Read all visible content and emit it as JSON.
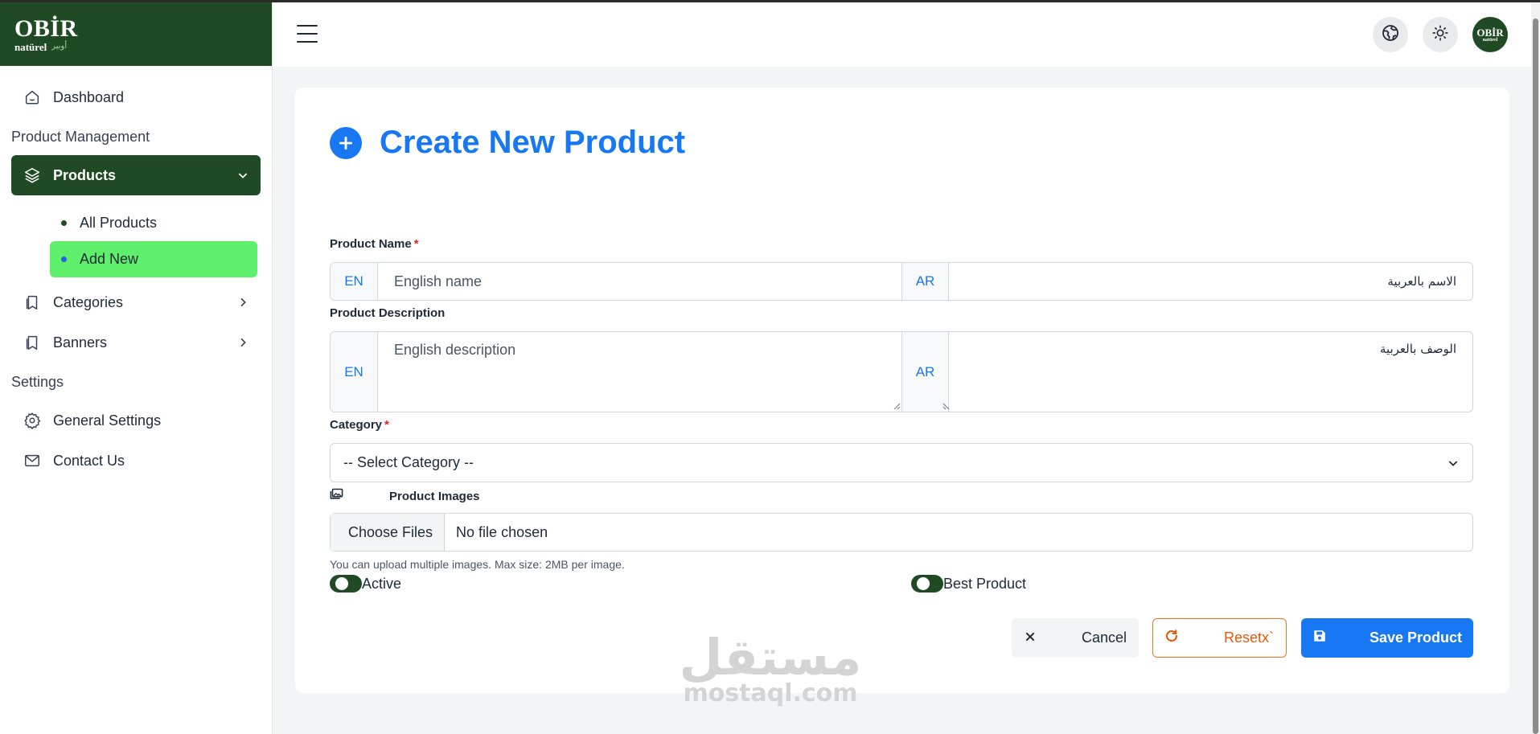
{
  "brand": {
    "logo_top": "OBİR",
    "logo_sub": "natürel",
    "logo_ar": "أوبير"
  },
  "sidebar": {
    "dashboard": "Dashboard",
    "section_product_management": "Product Management",
    "products": "Products",
    "all_products": "All Products",
    "add_new": "Add New",
    "categories": "Categories",
    "banners": "Banners",
    "section_settings": "Settings",
    "general_settings": "General Settings",
    "contact_us": "Contact Us"
  },
  "header": {
    "avatar_top": "OBİR",
    "avatar_sub": "natürel"
  },
  "form": {
    "title": "Create New Product",
    "required_mark": "*",
    "product_name_label": "Product Name",
    "lang_en": "EN",
    "lang_ar": "AR",
    "name_en_placeholder": "English name",
    "name_ar_placeholder": "الاسم بالعربية",
    "product_description_label": "Product Description",
    "desc_en_placeholder": "English description",
    "desc_ar_placeholder": "الوصف بالعربية",
    "category_label": "Category",
    "category_selected": "-- Select Category --",
    "product_images_label": "Product Images",
    "choose_files": "Choose Files",
    "no_file": "No file chosen",
    "upload_hint": "You can upload multiple images. Max size: 2MB per image.",
    "active_label": "Active",
    "active_on": true,
    "best_product_label": "Best Product",
    "best_product_on": true,
    "cancel": "Cancel",
    "reset": "Resetx`",
    "save": "Save Product"
  },
  "watermark": {
    "arabic": "مستقل",
    "latin": "mostaql.com"
  },
  "colors": {
    "brand_green": "#1f4a24",
    "active_green": "#5ef06a",
    "primary_blue": "#1877f2",
    "reset_orange": "#ea580c",
    "required_red": "#dc2626"
  }
}
